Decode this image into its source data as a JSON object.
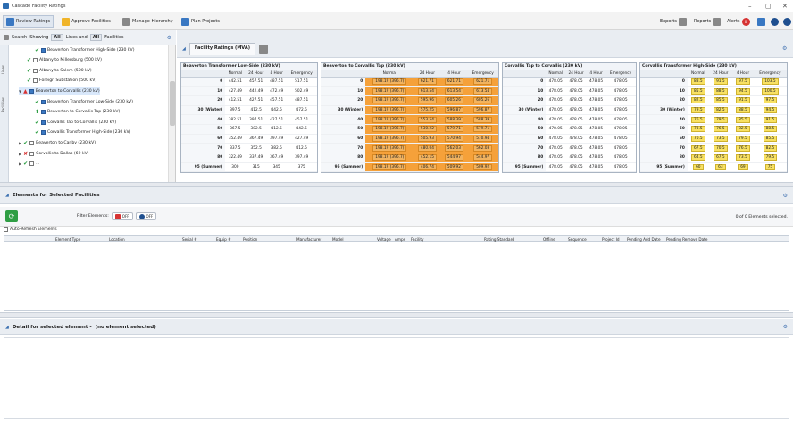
{
  "window": {
    "title": "Cascade Facility Ratings",
    "min": "–",
    "max": "▢",
    "close": "✕"
  },
  "toolbar": {
    "review": "Review Ratings",
    "approve": "Approve Facilities",
    "hierarchy": "Manage Hierarchy",
    "plan": "Plan Projects",
    "exports": "Exports",
    "reports": "Reports",
    "alerts": "Alerts",
    "alert_count": "0"
  },
  "left": {
    "search_label": "Search",
    "showing_label": "Showing",
    "all1": "All",
    "lines_label": "Lines and",
    "all2": "All",
    "facilities_label": "Facilities",
    "tab_lines": "Lines",
    "tab_facilities": "Facilities",
    "tree": [
      {
        "label": "Beaverton Transformer High-Side (230 kV)",
        "indent": 3,
        "mark": "tick",
        "checked": true
      },
      {
        "label": "Albany to Millersburg (500 kV)",
        "indent": 2,
        "mark": "tick",
        "checked": false
      },
      {
        "label": "Albany to Salem (500 kV)",
        "indent": 2,
        "mark": "tick",
        "checked": false
      },
      {
        "label": "Foreign Substation (500 kV)",
        "indent": 2,
        "mark": "tick",
        "checked": false
      },
      {
        "label": "Beaverton to Corvallis (230 kV)",
        "indent": 1,
        "mark": "warn",
        "checked": true,
        "selected": true
      },
      {
        "label": "Beaverton Transformer Low-Side (230 kV)",
        "indent": 3,
        "mark": "tick",
        "checked": true
      },
      {
        "label": "Beaverton to Corvallis Tap (230 kV)",
        "indent": 3,
        "mark": "up",
        "checked": true
      },
      {
        "label": "Corvallis Tap to Corvallis (230 kV)",
        "indent": 3,
        "mark": "tick",
        "checked": true
      },
      {
        "label": "Corvallis Transformer High-Side (230 kV)",
        "indent": 3,
        "mark": "tick",
        "checked": true
      },
      {
        "label": "Beaverton to Canby (230 kV)",
        "indent": 1,
        "mark": "tick",
        "checked": false
      },
      {
        "label": "Corvallis to Dallas (69 kV)",
        "indent": 1,
        "mark": "x",
        "checked": false
      },
      {
        "label": "...",
        "indent": 1,
        "mark": "tick",
        "checked": false
      }
    ]
  },
  "ratings": {
    "tab_label": "Facility Ratings (MVA)",
    "columns": [
      "Normal",
      "24 Hour",
      "4 Hour",
      "Emergency"
    ],
    "tables": [
      {
        "title": "Beaverton Transformer Low-Side (230 kV)",
        "style": "plain",
        "rows": [
          [
            "0",
            "442.51",
            "457.51",
            "487.51",
            "517.51"
          ],
          [
            "10",
            "427.49",
            "442.49",
            "472.49",
            "502.49"
          ],
          [
            "20",
            "412.51",
            "427.51",
            "457.51",
            "487.51"
          ],
          [
            "30 (Winter)",
            "397.5",
            "412.5",
            "442.5",
            "472.5"
          ],
          [
            "40",
            "382.51",
            "397.51",
            "427.51",
            "457.51"
          ],
          [
            "50",
            "367.5",
            "382.5",
            "412.5",
            "442.5"
          ],
          [
            "60",
            "352.49",
            "367.49",
            "397.49",
            "427.49"
          ],
          [
            "70",
            "337.5",
            "352.5",
            "382.5",
            "412.5"
          ],
          [
            "80",
            "322.49",
            "337.49",
            "367.49",
            "397.49"
          ],
          [
            "95 (Summer)",
            "300",
            "315",
            "345",
            "375"
          ]
        ]
      },
      {
        "title": "Beaverton to Corvallis Tap (230 kV)",
        "style": "orange",
        "rows": [
          [
            "0",
            "198.19 (396.7)",
            "621.71",
            "621.71",
            "621.71"
          ],
          [
            "10",
            "198.19 (396.7)",
            "613.54",
            "613.54",
            "613.54"
          ],
          [
            "20",
            "198.19 (396.7)",
            "595.96",
            "605.26",
            "605.26"
          ],
          [
            "30 (Winter)",
            "198.19 (396.7)",
            "575.25",
            "596.87",
            "596.87"
          ],
          [
            "40",
            "198.19 (396.7)",
            "553.54",
            "588.39",
            "588.39"
          ],
          [
            "50",
            "198.19 (396.7)",
            "530.22",
            "579.71",
            "579.71"
          ],
          [
            "60",
            "198.19 (396.7)",
            "505.93",
            "570.94",
            "570.94"
          ],
          [
            "70",
            "198.19 (396.7)",
            "480.04",
            "562.03",
            "562.03"
          ],
          [
            "80",
            "198.19 (396.7)",
            "452.15",
            "544.97",
            "544.97"
          ],
          [
            "95 (Summer)",
            "198.19 (396.7)",
            "406.74",
            "509.92",
            "509.92"
          ]
        ]
      },
      {
        "title": "Corvallis Tap to Corvallis (230 kV)",
        "style": "plain",
        "rows": [
          [
            "0",
            "478.05",
            "478.05",
            "478.05",
            "478.05"
          ],
          [
            "10",
            "478.05",
            "478.05",
            "478.05",
            "478.05"
          ],
          [
            "20",
            "478.05",
            "478.05",
            "478.05",
            "478.05"
          ],
          [
            "30 (Winter)",
            "478.05",
            "478.05",
            "478.05",
            "478.05"
          ],
          [
            "40",
            "478.05",
            "478.05",
            "478.05",
            "478.05"
          ],
          [
            "50",
            "478.05",
            "478.05",
            "478.05",
            "478.05"
          ],
          [
            "60",
            "478.05",
            "478.05",
            "478.05",
            "478.05"
          ],
          [
            "70",
            "478.05",
            "478.05",
            "478.05",
            "478.05"
          ],
          [
            "80",
            "478.05",
            "478.05",
            "478.05",
            "478.05"
          ],
          [
            "95 (Summer)",
            "478.05",
            "478.05",
            "478.05",
            "478.05"
          ]
        ]
      },
      {
        "title": "Corvallis Transformer High-Side (230 kV)",
        "style": "yellow",
        "rows": [
          [
            "0",
            "88.5",
            "91.5",
            "97.5",
            "103.5"
          ],
          [
            "10",
            "85.5",
            "88.5",
            "94.5",
            "100.5"
          ],
          [
            "20",
            "82.5",
            "85.5",
            "91.5",
            "97.5"
          ],
          [
            "30 (Winter)",
            "79.5",
            "82.5",
            "88.5",
            "94.5"
          ],
          [
            "40",
            "76.5",
            "79.5",
            "85.5",
            "91.5"
          ],
          [
            "50",
            "73.5",
            "76.5",
            "82.5",
            "88.5"
          ],
          [
            "60",
            "70.5",
            "73.5",
            "79.5",
            "85.5"
          ],
          [
            "70",
            "67.5",
            "70.5",
            "76.5",
            "82.5"
          ],
          [
            "80",
            "64.5",
            "67.5",
            "73.5",
            "79.5"
          ],
          [
            "95 (Summer)",
            "60",
            "63",
            "69",
            "75"
          ]
        ]
      }
    ]
  },
  "elements": {
    "title": "Elements for Selected Facilities",
    "filter_label": "Filter Elements:",
    "filter_off1": "OFF",
    "filter_off2": "OFF",
    "count_text": "0 of 0 Elements selected.",
    "auto_refresh": "Auto-Refresh Elements",
    "headers": [
      "Element Type",
      "Location",
      "Serial #",
      "Equip #",
      "Position",
      "Manufacturer",
      "Model",
      "Voltage",
      "Amps",
      "Facility",
      "Rating Standard",
      "Offline",
      "Sequence",
      "Project Id",
      "Pending Add Date",
      "Pending Remove Date"
    ]
  },
  "detail": {
    "title": "Detail for selected element -",
    "status": "(no element selected)"
  }
}
